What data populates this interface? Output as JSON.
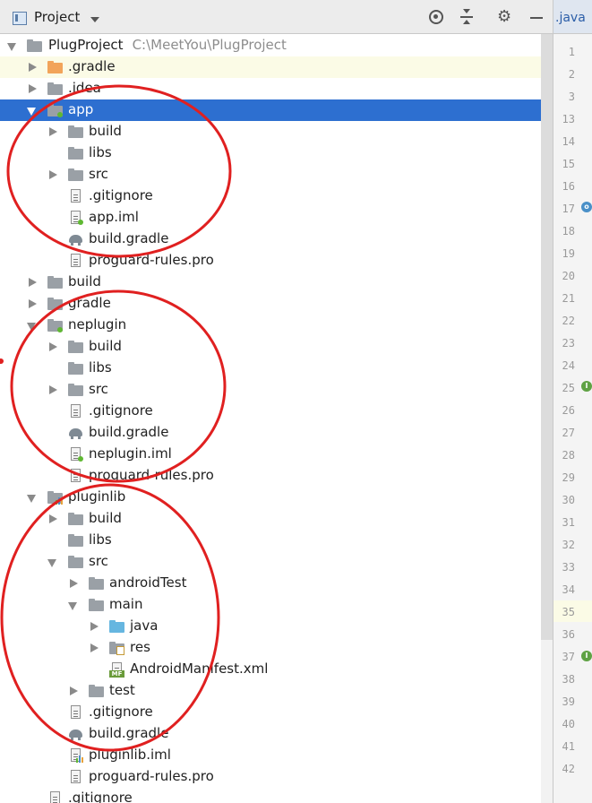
{
  "panel": {
    "title": "Project"
  },
  "editor": {
    "tab_label": ".java"
  },
  "tree": {
    "root": {
      "name": "PlugProject",
      "path": "C:\\MeetYou\\PlugProject"
    },
    "items": [
      {
        "label": ".gradle"
      },
      {
        "label": ".idea"
      },
      {
        "label": "app"
      },
      {
        "label": "build"
      },
      {
        "label": "libs"
      },
      {
        "label": "src"
      },
      {
        "label": ".gitignore"
      },
      {
        "label": "app.iml"
      },
      {
        "label": "build.gradle"
      },
      {
        "label": "proguard-rules.pro"
      },
      {
        "label": "build"
      },
      {
        "label": "gradle"
      },
      {
        "label": "neplugin"
      },
      {
        "label": "build"
      },
      {
        "label": "libs"
      },
      {
        "label": "src"
      },
      {
        "label": ".gitignore"
      },
      {
        "label": "build.gradle"
      },
      {
        "label": "neplugin.iml"
      },
      {
        "label": "proguard-rules.pro"
      },
      {
        "label": "pluginlib"
      },
      {
        "label": "build"
      },
      {
        "label": "libs"
      },
      {
        "label": "src"
      },
      {
        "label": "androidTest"
      },
      {
        "label": "main"
      },
      {
        "label": "java"
      },
      {
        "label": "res"
      },
      {
        "label": "AndroidManifest.xml"
      },
      {
        "label": "test"
      },
      {
        "label": ".gitignore"
      },
      {
        "label": "build.gradle"
      },
      {
        "label": "pluginlib.iml"
      },
      {
        "label": "proguard-rules.pro"
      },
      {
        "label": ".gitignore"
      }
    ]
  },
  "gutter": {
    "line_numbers": [
      "1",
      "2",
      "3",
      "13",
      "14",
      "15",
      "16",
      "17",
      "18",
      "19",
      "20",
      "21",
      "22",
      "23",
      "24",
      "25",
      "26",
      "27",
      "28",
      "29",
      "30",
      "31",
      "32",
      "33",
      "34",
      "35",
      "36",
      "37",
      "38",
      "39",
      "40",
      "41",
      "42"
    ]
  },
  "colors": {
    "selection": "#2d6fd0",
    "annotation_circle": "#e02020",
    "module_dot": "#5fb832"
  }
}
